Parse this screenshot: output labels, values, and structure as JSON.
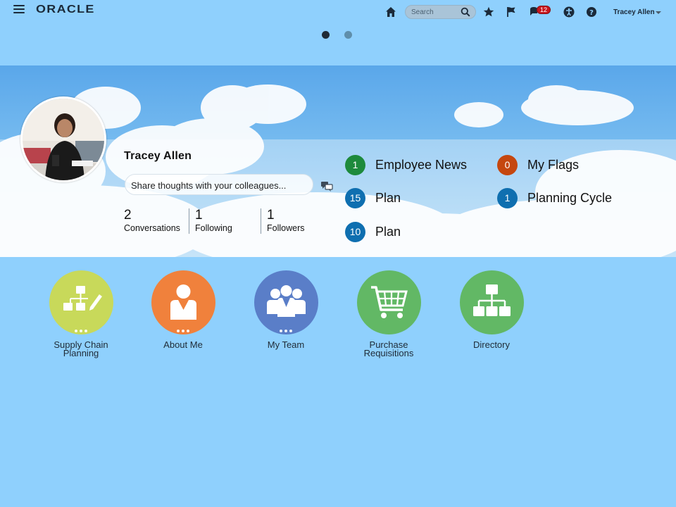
{
  "header": {
    "logo": "ORACLE",
    "search_placeholder": "Search",
    "notification_count": "12",
    "user_name": "Tracey Allen"
  },
  "carousel": {
    "pages": 2,
    "active": 1
  },
  "profile": {
    "name": "Tracey Allen",
    "share_placeholder": "Share thoughts with your colleagues...",
    "stats": [
      {
        "value": "2",
        "label": "Conversations"
      },
      {
        "value": "1",
        "label": "Following"
      },
      {
        "value": "1",
        "label": "Followers"
      }
    ]
  },
  "feed": [
    {
      "count": "1",
      "label": "Employee News",
      "color": "#1e8a3c"
    },
    {
      "count": "15",
      "label": "Plan",
      "color": "#0f6fb0"
    },
    {
      "count": "10",
      "label": "Plan",
      "color": "#0f6fb0"
    },
    {
      "count": "0",
      "label": "My Flags",
      "color": "#c5470f"
    },
    {
      "count": "1",
      "label": "Planning Cycle",
      "color": "#0f6fb0"
    }
  ],
  "tiles": [
    {
      "label_line1": "Supply Chain",
      "label_line2": "Planning",
      "color": "#c8d95a",
      "icon": "flow-edit-icon"
    },
    {
      "label_line1": "About Me",
      "label_line2": "",
      "color": "#f0813c",
      "icon": "person-icon"
    },
    {
      "label_line1": "My Team",
      "label_line2": "",
      "color": "#5a7ec8",
      "icon": "team-icon"
    },
    {
      "label_line1": "Purchase",
      "label_line2": "Requisitions",
      "color": "#62b865",
      "icon": "cart-icon"
    },
    {
      "label_line1": "Directory",
      "label_line2": "",
      "color": "#62b865",
      "icon": "org-chart-icon"
    }
  ],
  "colors": {
    "page_bg": "#8fd0fd",
    "accent_dark": "#1b2a3a",
    "badge": "#c8161d"
  }
}
